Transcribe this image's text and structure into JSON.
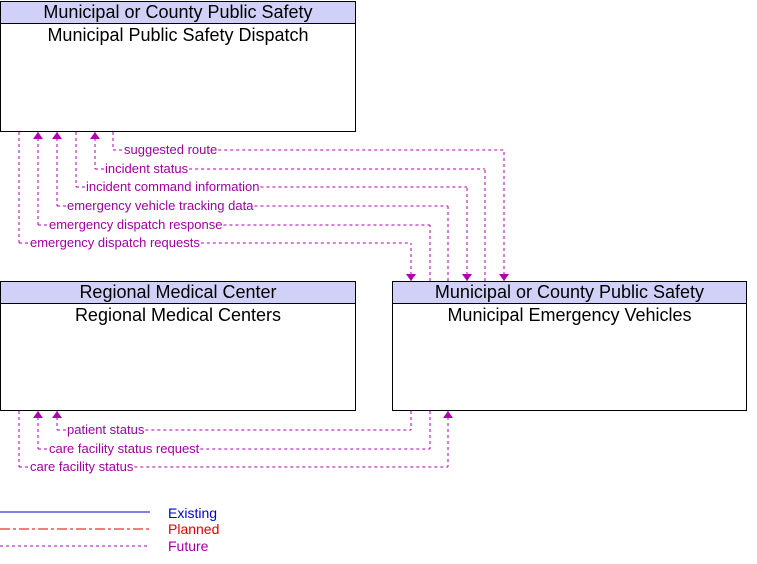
{
  "colors": {
    "future": "#b000b0",
    "existing": "#0000d0",
    "planned": "#e00000",
    "header_bg": "#d0d0f8"
  },
  "boxes": {
    "dispatch": {
      "header": "Municipal or County Public Safety",
      "title": "Municipal Public Safety Dispatch"
    },
    "medical": {
      "header": "Regional Medical Center",
      "title": "Regional Medical Centers"
    },
    "vehicles": {
      "header": "Municipal or County Public Safety",
      "title": "Municipal Emergency Vehicles"
    }
  },
  "flows": [
    {
      "label": "suggested route",
      "from": "dispatch",
      "to": "vehicles",
      "status": "Future"
    },
    {
      "label": "incident status",
      "from": "vehicles",
      "to": "dispatch",
      "status": "Future"
    },
    {
      "label": "incident command information",
      "from": "dispatch",
      "to": "vehicles",
      "status": "Future"
    },
    {
      "label": "emergency vehicle tracking data",
      "from": "vehicles",
      "to": "dispatch",
      "status": "Future"
    },
    {
      "label": "emergency dispatch response",
      "from": "vehicles",
      "to": "dispatch",
      "status": "Future"
    },
    {
      "label": "emergency dispatch requests",
      "from": "dispatch",
      "to": "vehicles",
      "status": "Future"
    },
    {
      "label": "patient status",
      "from": "vehicles",
      "to": "medical",
      "status": "Future"
    },
    {
      "label": "care facility status request",
      "from": "vehicles",
      "to": "medical",
      "status": "Future"
    },
    {
      "label": "care facility status",
      "from": "medical",
      "to": "vehicles",
      "status": "Future"
    }
  ],
  "legend": {
    "existing": "Existing",
    "planned": "Planned",
    "future": "Future"
  }
}
